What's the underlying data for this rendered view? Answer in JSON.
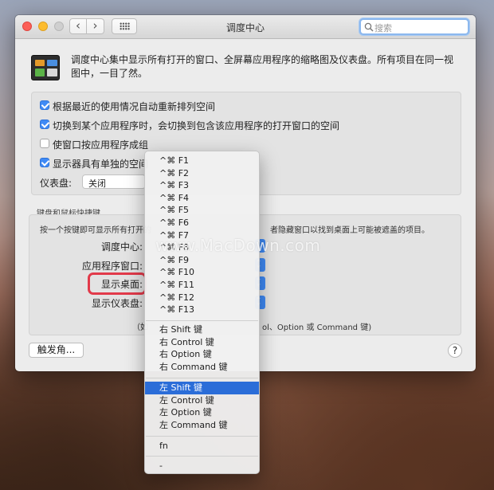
{
  "window": {
    "title": "调度中心",
    "search_placeholder": "搜索",
    "nav_back": "‹",
    "nav_forward": "›"
  },
  "description": "调度中心集中显示所有打开的窗口、全屏幕应用程序的缩略图及仪表盘。所有项目在同一视图中，一目了然。",
  "options": [
    {
      "label": "根据最近的使用情况自动重新排列空间",
      "checked": true
    },
    {
      "label": "切换到某个应用程序时，会切换到包含该应用程序的打开窗口的空间",
      "checked": true
    },
    {
      "label": "使窗口按应用程序成组",
      "checked": false
    },
    {
      "label": "显示器具有单独的空间",
      "checked": true
    }
  ],
  "dashboard": {
    "label": "仪表盘:",
    "value": "关闭"
  },
  "shortcuts": {
    "section_title": "键盘和鼠标快捷键",
    "description_left": "按一个按键即可显示所有打开的",
    "description_right": "者隐藏窗口以找到桌面上可能被遮盖的项目。",
    "rows": [
      {
        "label": "调度中心:"
      },
      {
        "label": "应用程序窗口:"
      },
      {
        "label": "显示桌面:"
      },
      {
        "label": "显示仪表盘:"
      }
    ],
    "hint_left": "（如",
    "hint_right": "ol、Option 或 Command 键)"
  },
  "hot_corners_label": "触发角...",
  "help_label": "?",
  "menu": {
    "fkeys": [
      "^⌘ F1",
      "^⌘ F2",
      "^⌘ F3",
      "^⌘ F4",
      "^⌘ F5",
      "^⌘ F6",
      "^⌘ F7",
      "^⌘ F8",
      "^⌘ F9",
      "^⌘ F10",
      "^⌘ F11",
      "^⌘ F12",
      "^⌘ F13"
    ],
    "right_keys": [
      "右 Shift 键",
      "右 Control 键",
      "右 Option 键",
      "右 Command 键"
    ],
    "left_keys": [
      "左 Shift 键",
      "左 Control 键",
      "左 Option 键",
      "左 Command 键"
    ],
    "selected": "左 Shift 键",
    "fn": "fn",
    "none": "-"
  },
  "watermark": "www.MacDown.com"
}
